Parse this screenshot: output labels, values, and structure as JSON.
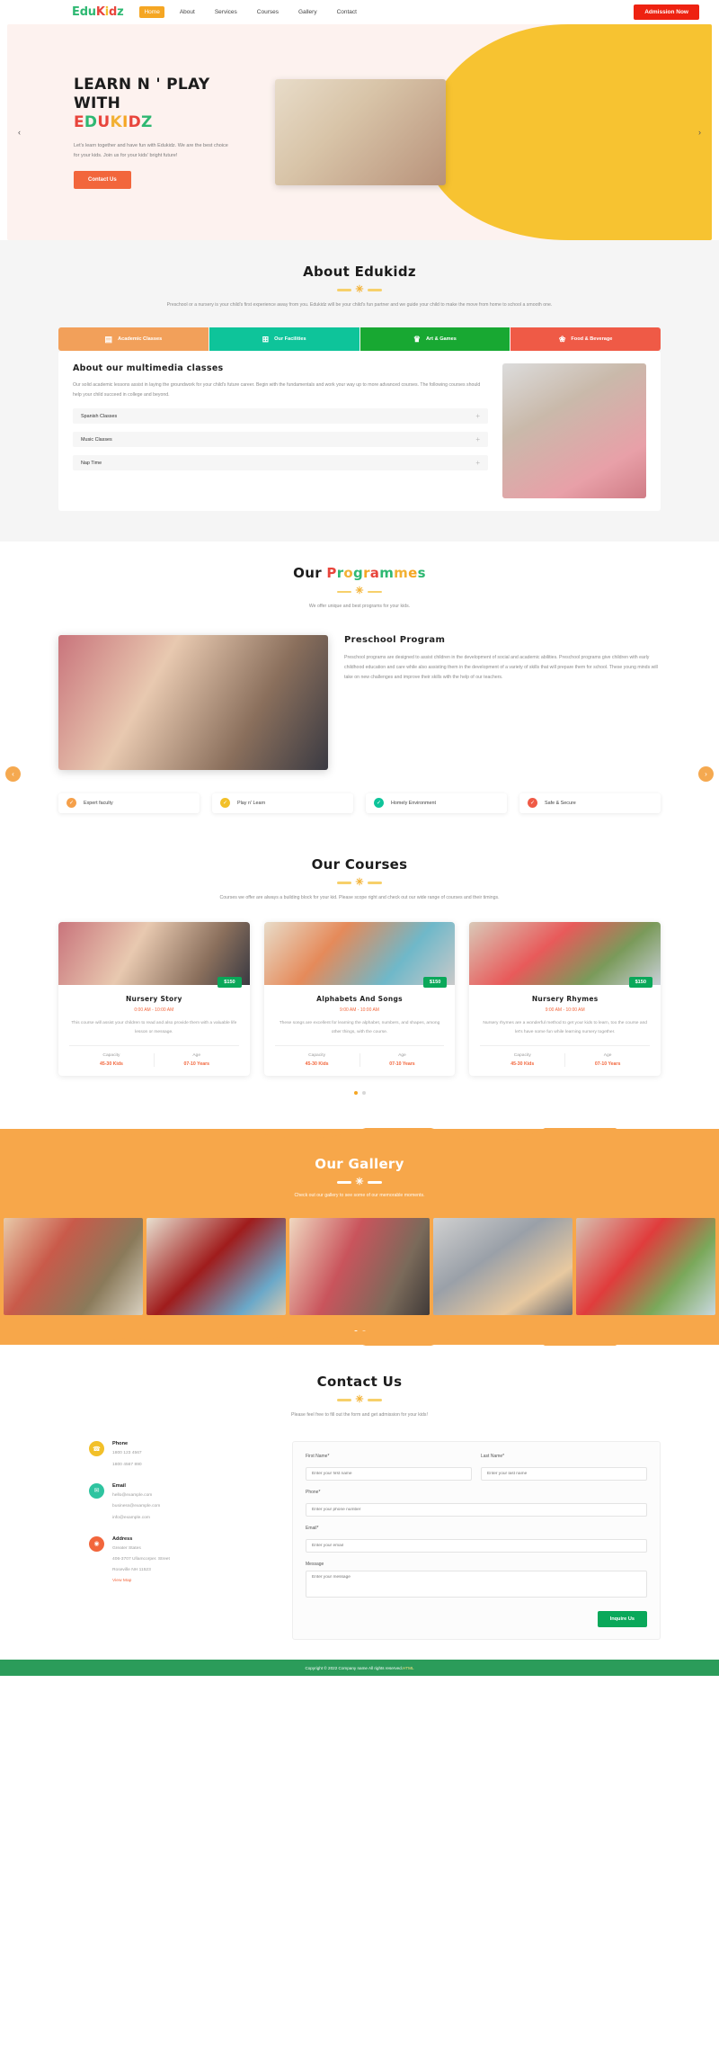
{
  "header": {
    "logo_parts": [
      "E",
      "d",
      "u",
      "K",
      "i",
      "d",
      "z"
    ],
    "nav": [
      {
        "label": "Home",
        "active": true
      },
      {
        "label": "About",
        "active": false
      },
      {
        "label": "Services",
        "active": false
      },
      {
        "label": "Courses",
        "active": false
      },
      {
        "label": "Gallery",
        "active": false
      },
      {
        "label": "Contact",
        "active": false
      }
    ],
    "cta": "Admission Now"
  },
  "hero": {
    "title_line1": "LEARN N ' PLAY WITH",
    "title_line2": "EDUKIDZ",
    "paragraph": "Let's learn together and have fun with Edukidz. We are the best choice for your kids. Join us for your kids' bright future!",
    "button": "Contact Us",
    "prev_arrow": "‹",
    "next_arrow": "›"
  },
  "about": {
    "title": "About Edukidz",
    "subtitle": "Preschool or a nursery is your child's first experience away from you. Edukidz will be your child's fun partner and we guide your child to make the move from home to school a smooth one.",
    "tabs": [
      {
        "label": "Academic Classes",
        "icon": "books-icon",
        "glyph": "▤",
        "color": "#f2a05a"
      },
      {
        "label": "Our Facilities",
        "icon": "blocks-icon",
        "glyph": "⊞",
        "color": "#0ec49a"
      },
      {
        "label": "Art & Games",
        "icon": "crown-icon",
        "glyph": "♛",
        "color": "#18a832"
      },
      {
        "label": "Food & Beverage",
        "icon": "food-icon",
        "glyph": "❀",
        "color": "#ef5a46"
      }
    ],
    "card_heading": "About our multimedia classes",
    "card_paragraph": "Our solid academic lessons assist in laying the groundwork for your child's future career. Begin with the fundamentals and work your way up to more advanced courses. The following courses should help your child succeed in college and beyond.",
    "accordion": [
      {
        "label": "Spanish Classes",
        "toggle": "+"
      },
      {
        "label": "Music Classes",
        "toggle": "+"
      },
      {
        "label": "Nap Time",
        "toggle": "+"
      }
    ]
  },
  "programmes": {
    "title_plain": "Our ",
    "title_colored": "Programmes",
    "subtitle": "We offer unique and best programs for your kids.",
    "heading": "Preschool Program",
    "paragraph": "Preschool programs are designed to assist children in the development of social and academic abilities. Preschool programs give children with early childhood education and care while also assisting them in the development of a variety of skills that will prepare them for school. These young minds will take on new challenges and improve their skills with the help of our teachers.",
    "prev_arrow": "‹",
    "next_arrow": "›",
    "features": [
      {
        "label": "Expert faculty",
        "color": "#f5a04a",
        "check": "✓"
      },
      {
        "label": "Play n' Learn",
        "color": "#f2c029",
        "check": "✓"
      },
      {
        "label": "Homely Environment",
        "color": "#0ec49a",
        "check": "✓"
      },
      {
        "label": "Safe & Secure",
        "color": "#ef5a46",
        "check": "✓"
      }
    ]
  },
  "courses": {
    "title": "Our Courses",
    "subtitle": "Courses we offer are always a building block for your kid. Please scope right and check out our wide range of courses and their timings.",
    "items": [
      {
        "name": "Nursery Story",
        "time": "0:00 AM - 10:00 AM",
        "price": "$150",
        "desc": "This course will assist your children to read and also provide them with a valuable life lesson or message.",
        "capacity_label": "Capacity",
        "capacity_value": "45-30 Kids",
        "age_label": "Age",
        "age_value": "07-10 Years"
      },
      {
        "name": "Alphabets And Songs",
        "time": "9:00 AM - 10:00 AM",
        "price": "$150",
        "desc": "These songs are excellent for learning the alphabet, numbers, and shapes, among other things, with the course.",
        "capacity_label": "Capacity",
        "capacity_value": "45-30 Kids",
        "age_label": "Age",
        "age_value": "07-10 Years"
      },
      {
        "name": "Nursery Rhymes",
        "time": "9:00 AM - 10:00 AM",
        "price": "$150",
        "desc": "Nursery rhymes are a wonderful method to get your kids to learn, too the course and let's have some fun while learning nursery together.",
        "capacity_label": "Capacity",
        "capacity_value": "45-30 Kids",
        "age_label": "Age",
        "age_value": "07-10 Years"
      }
    ],
    "dots": [
      true,
      false
    ]
  },
  "gallery": {
    "title": "Our Gallery",
    "subtitle": "Check out our gallery to see some of our memorable moments.",
    "dots": [
      true,
      false
    ]
  },
  "contact": {
    "title": "Contact Us",
    "subtitle": "Please feel free to fill out the form and get admission for your kids!",
    "blocks": [
      {
        "icon": "phone-icon",
        "glyph": "☎",
        "heading": "Phone",
        "lines": [
          "1800 123 4567",
          "1800 4567 890"
        ]
      },
      {
        "icon": "mail-icon",
        "glyph": "✉",
        "heading": "Email",
        "lines": [
          "hello@example.com",
          "business@example.com",
          "info@example.com"
        ]
      },
      {
        "icon": "location-icon",
        "glyph": "◉",
        "heading": "Address",
        "lines": [
          "Greater States",
          "406-3707 Ullamcorper. Street",
          "Roseville NH 11523"
        ],
        "map_link": "View Map"
      }
    ],
    "form": {
      "first_name_label": "First Name*",
      "first_name_placeholder": "Enter your first name",
      "last_name_label": "Last Name*",
      "last_name_placeholder": "Enter your last name",
      "phone_label": "Phone*",
      "phone_placeholder": "Enter your phone number",
      "email_label": "Email*",
      "email_placeholder": "Enter your email",
      "message_label": "Message",
      "message_placeholder": "Enter your message",
      "submit": "Inquire Us"
    }
  },
  "footer": {
    "text": "Copyright © 2022 Company name All rights reserved.",
    "highlight": "HTML"
  }
}
